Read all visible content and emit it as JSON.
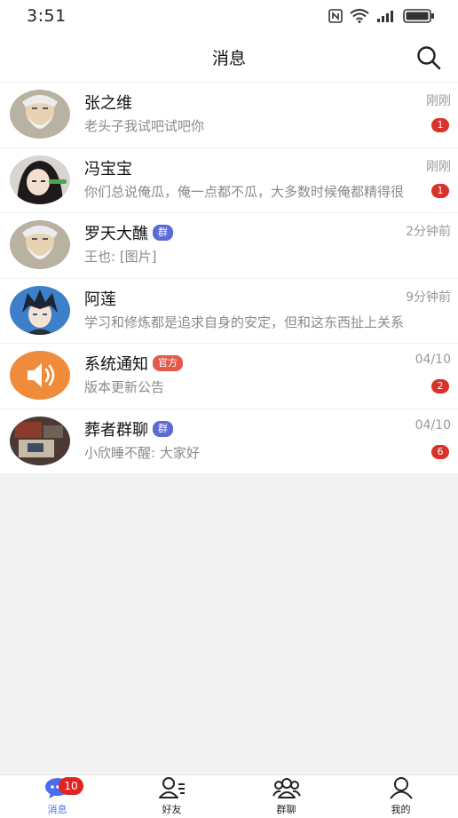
{
  "status_bar": {
    "time": "3:51"
  },
  "header": {
    "title": "消息",
    "search_icon": "search-icon"
  },
  "conversations": [
    {
      "name": "张之维",
      "tag": "",
      "time": "刚刚",
      "preview": "老头子我试吧试吧你",
      "unread": "1",
      "avatar": "old-man-avatar"
    },
    {
      "name": "冯宝宝",
      "tag": "",
      "time": "刚刚",
      "preview": "你们总说俺瓜，俺一点都不瓜，大多数时候俺都精得很",
      "unread": "1",
      "avatar": "girl-avatar"
    },
    {
      "name": "罗天大醮",
      "tag": "群",
      "time": "2分钟前",
      "preview": "王也: [图片]",
      "unread": "",
      "avatar": "old-man-avatar"
    },
    {
      "name": "阿莲",
      "tag": "",
      "time": "9分钟前",
      "preview": "学习和修炼都是追求自身的安定，但和这东西扯上关系",
      "unread": "",
      "avatar": "boy-avatar"
    },
    {
      "name": "系统通知",
      "tag": "官方",
      "time": "04/10",
      "preview": "版本更新公告",
      "unread": "2",
      "avatar": "speaker-icon"
    },
    {
      "name": "葬者群聊",
      "tag": "群",
      "time": "04/10",
      "preview": "小欣睡不醒: 大家好",
      "unread": "6",
      "avatar": "photo-avatar"
    }
  ],
  "tabs": [
    {
      "label": "消息",
      "icon": "chat-bubble-icon",
      "badge": "10",
      "active": true
    },
    {
      "label": "好友",
      "icon": "friends-icon",
      "badge": "",
      "active": false
    },
    {
      "label": "群聊",
      "icon": "group-chat-icon",
      "badge": "",
      "active": false
    },
    {
      "label": "我的",
      "icon": "profile-icon",
      "badge": "",
      "active": false
    }
  ],
  "colors": {
    "accent": "#4a6cf0",
    "badge": "#d9322b",
    "group_tag": "#5b6bd6",
    "official_tag": "#e25a4b",
    "speaker_bg": "#ef8b3a"
  }
}
